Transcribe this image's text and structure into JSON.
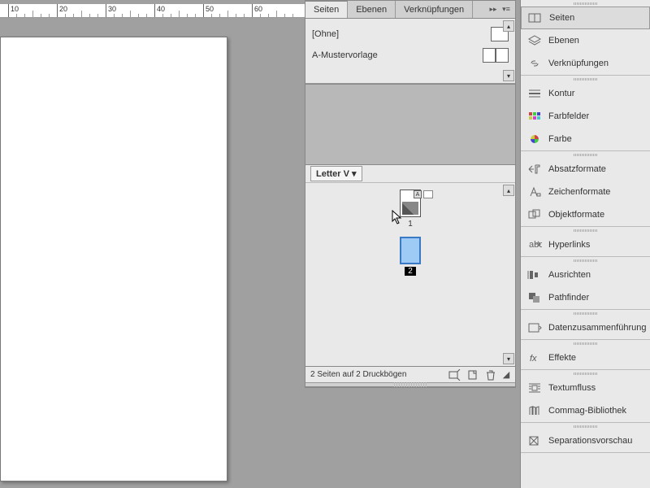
{
  "ruler": {
    "marks": [
      10,
      20,
      30,
      40,
      50,
      60
    ]
  },
  "pagesPanel": {
    "tabs": [
      {
        "label": "Seiten",
        "active": true
      },
      {
        "label": "Ebenen",
        "active": false
      },
      {
        "label": "Verknüpfungen",
        "active": false
      }
    ],
    "masters": [
      {
        "name": "[Ohne]",
        "double": false
      },
      {
        "name": "A-Mustervorlage",
        "double": true
      }
    ],
    "sizeDropdown": "Letter V",
    "pages": [
      {
        "num": "1",
        "badge": "A",
        "hasImage": true,
        "selected": false
      },
      {
        "num": "2",
        "badge": "",
        "hasImage": false,
        "selected": true
      }
    ],
    "status": "2 Seiten auf 2 Druckbögen"
  },
  "rightPanels": {
    "groups": [
      [
        {
          "icon": "pages",
          "label": "Seiten",
          "active": true
        },
        {
          "icon": "layers",
          "label": "Ebenen"
        },
        {
          "icon": "links",
          "label": "Verknüpfungen"
        }
      ],
      [
        {
          "icon": "stroke",
          "label": "Kontur"
        },
        {
          "icon": "swatches",
          "label": "Farbfelder"
        },
        {
          "icon": "color",
          "label": "Farbe"
        }
      ],
      [
        {
          "icon": "para",
          "label": "Absatzformate"
        },
        {
          "icon": "char",
          "label": "Zeichenformate"
        },
        {
          "icon": "obj",
          "label": "Objektformate"
        }
      ],
      [
        {
          "icon": "hyperlink",
          "label": "Hyperlinks"
        }
      ],
      [
        {
          "icon": "align",
          "label": "Ausrichten"
        },
        {
          "icon": "pathfinder",
          "label": "Pathfinder"
        }
      ],
      [
        {
          "icon": "datamerge",
          "label": "Datenzusammenführung"
        }
      ],
      [
        {
          "icon": "fx",
          "label": "Effekte"
        }
      ],
      [
        {
          "icon": "textwrap",
          "label": "Textumfluss"
        },
        {
          "icon": "library",
          "label": "Commag-Bibliothek"
        }
      ],
      [
        {
          "icon": "sep",
          "label": "Separationsvorschau"
        }
      ]
    ]
  }
}
